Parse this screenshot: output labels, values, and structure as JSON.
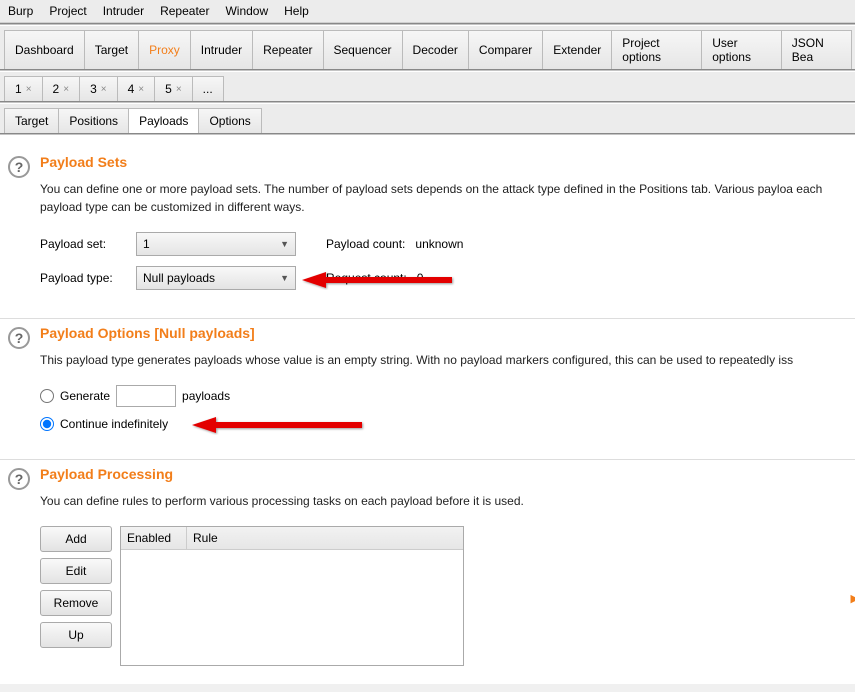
{
  "menu": {
    "items": [
      "Burp",
      "Project",
      "Intruder",
      "Repeater",
      "Window",
      "Help"
    ]
  },
  "topTabs": [
    "Dashboard",
    "Target",
    "Proxy",
    "Intruder",
    "Repeater",
    "Sequencer",
    "Decoder",
    "Comparer",
    "Extender",
    "Project options",
    "User options",
    "JSON Bea"
  ],
  "topTabsActive": "Proxy",
  "numTabs": [
    "1",
    "2",
    "3",
    "4",
    "5",
    "..."
  ],
  "subTabs": [
    "Target",
    "Positions",
    "Payloads",
    "Options"
  ],
  "subTabsActive": "Payloads",
  "payloadSets": {
    "title": "Payload Sets",
    "desc": "You can define one or more payload sets. The number of payload sets depends on the attack type defined in the Positions tab. Various payloa each payload type can be customized in different ways.",
    "setLabel": "Payload set:",
    "setValue": "1",
    "typeLabel": "Payload type:",
    "typeValue": "Null payloads",
    "payloadCountLabel": "Payload count:",
    "payloadCountValue": "unknown",
    "requestCountLabel": "Request count:",
    "requestCountValue": "0"
  },
  "payloadOptions": {
    "title": "Payload Options [Null payloads]",
    "desc": "This payload type generates payloads whose value is an empty string. With no payload markers configured, this can be used to repeatedly iss",
    "generateLabel": "Generate",
    "generateSuffix": "payloads",
    "generateValue": "",
    "continueLabel": "Continue indefinitely",
    "selected": "continue"
  },
  "payloadProcessing": {
    "title": "Payload Processing",
    "desc": "You can define rules to perform various processing tasks on each payload before it is used.",
    "buttons": [
      "Add",
      "Edit",
      "Remove",
      "Up"
    ],
    "cols": [
      "Enabled",
      "Rule"
    ]
  }
}
